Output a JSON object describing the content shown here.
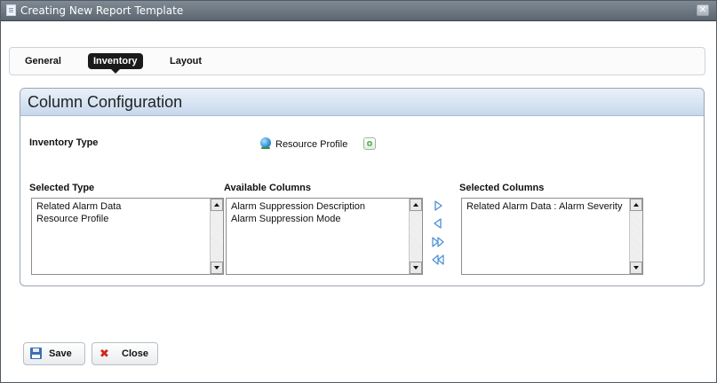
{
  "window": {
    "title": "Creating New Report Template",
    "close_icon": "close-icon"
  },
  "tabs": [
    {
      "label": "General",
      "active": false
    },
    {
      "label": "Inventory",
      "active": true
    },
    {
      "label": "Layout",
      "active": false
    }
  ],
  "panel": {
    "title": "Column Configuration",
    "inventory_type_label": "Inventory Type",
    "inventory_type_value": "Resource Profile",
    "selected_type_label": "Selected Type",
    "available_columns_label": "Available Columns",
    "selected_columns_label": "Selected Columns",
    "selected_type_items": [
      "Related Alarm Data",
      "Resource Profile"
    ],
    "available_columns_items": [
      "Alarm Suppression Description",
      "Alarm Suppression Mode"
    ],
    "selected_columns_items": [
      "Related Alarm Data : Alarm Severity"
    ]
  },
  "buttons": {
    "save": "Save",
    "close": "Close"
  },
  "colors": {
    "titlebar": "#5b6670",
    "active_tab": "#1a1a1a",
    "arrow": "#4a8fd6",
    "panel_header": "#c7d8ec"
  }
}
